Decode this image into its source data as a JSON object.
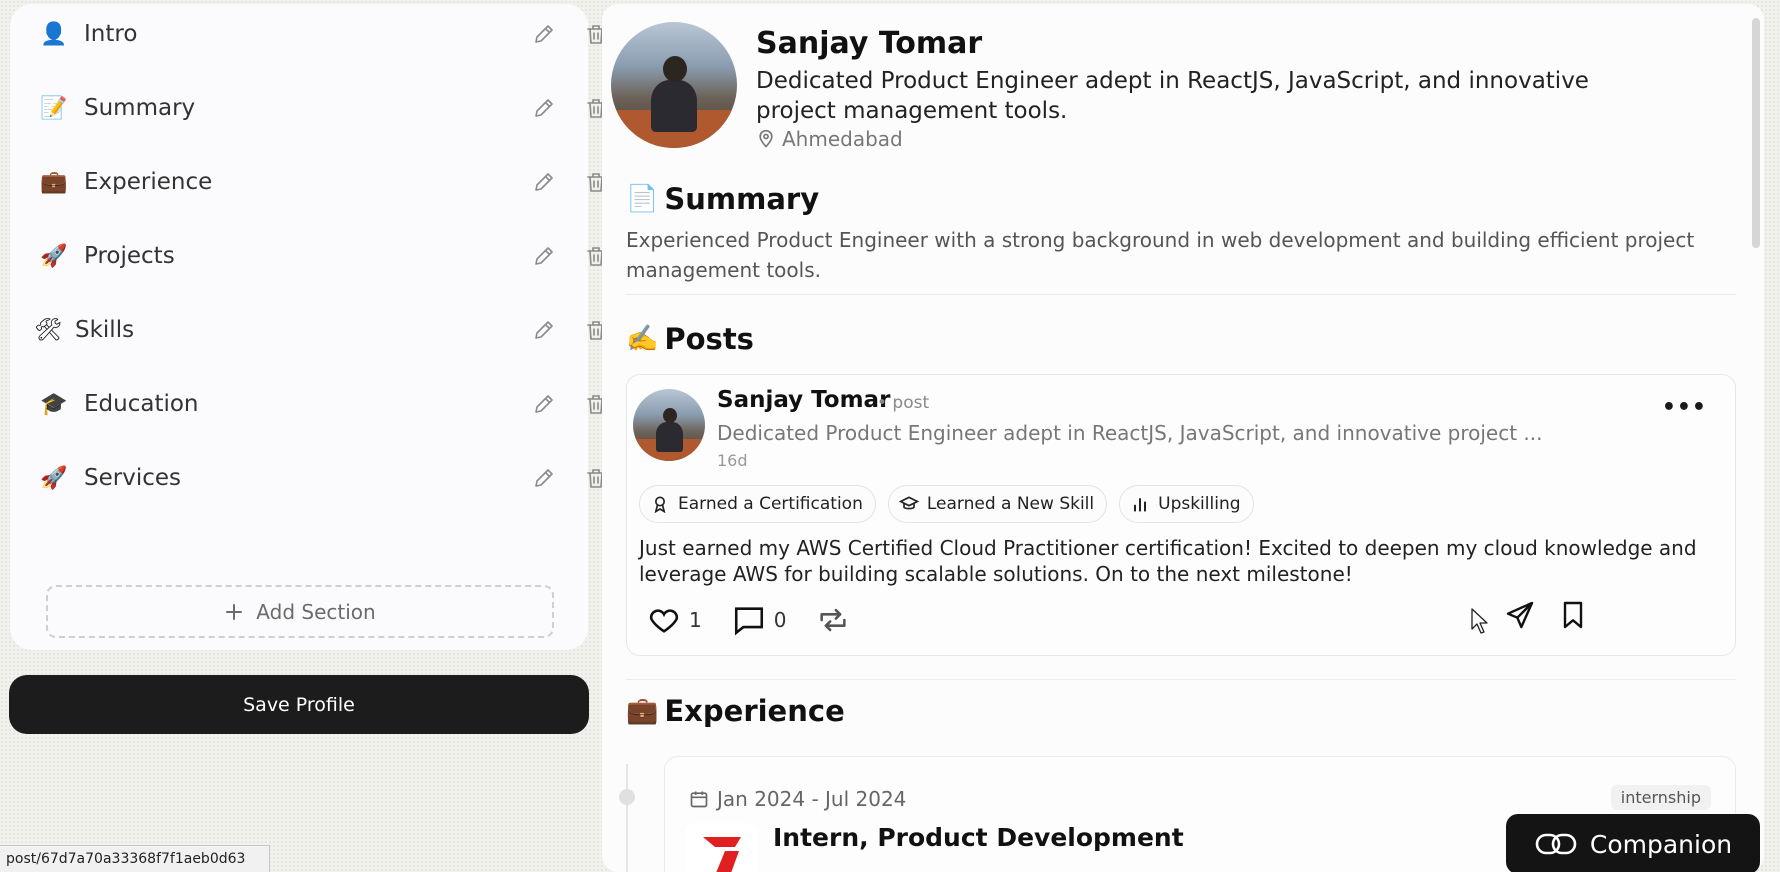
{
  "sections": [
    {
      "emoji": "👤",
      "label": "Intro"
    },
    {
      "emoji": "📝",
      "label": "Summary"
    },
    {
      "emoji": "💼",
      "label": "Experience"
    },
    {
      "emoji": "🚀",
      "label": "Projects"
    },
    {
      "emoji": "🛠",
      "label": "Skills"
    },
    {
      "emoji": "🎓",
      "label": "Education"
    },
    {
      "emoji": "🚀",
      "label": "Services"
    }
  ],
  "add_section_label": "Add Section",
  "save_label": "Save Profile",
  "status_url": "post/67d7a70a33368f7f1aeb0d63",
  "profile": {
    "name": "Sanjay Tomar",
    "headline": "Dedicated Product Engineer adept in ReactJS, JavaScript, and innovative project management tools.",
    "location": "Ahmedabad"
  },
  "summary": {
    "emoji": "📄",
    "title": "Summary",
    "text": "Experienced Product Engineer with a strong background in web development and building efficient project management tools."
  },
  "posts": {
    "emoji": "✍️",
    "title": "Posts",
    "post": {
      "author": "Sanjay Tomar",
      "type": "• post",
      "headline": "Dedicated Product Engineer adept in ReactJS, JavaScript, and innovative project ...",
      "time": "16d",
      "more": "•••",
      "tags": [
        "Earned a Certification",
        "Learned a New Skill",
        "Upskilling"
      ],
      "body": "Just earned my AWS Certified Cloud Practitioner certification! Excited to deepen my cloud knowledge and leverage AWS for building scalable solutions. On to the next milestone!",
      "likes": "1",
      "comments": "0"
    }
  },
  "experience": {
    "emoji": "💼",
    "title": "Experience",
    "item": {
      "date": "Jan 2024 - Jul 2024",
      "badge": "internship",
      "title": "Intern, Product Development",
      "logo_color": "#e02020"
    }
  },
  "companion_label": "Companion"
}
